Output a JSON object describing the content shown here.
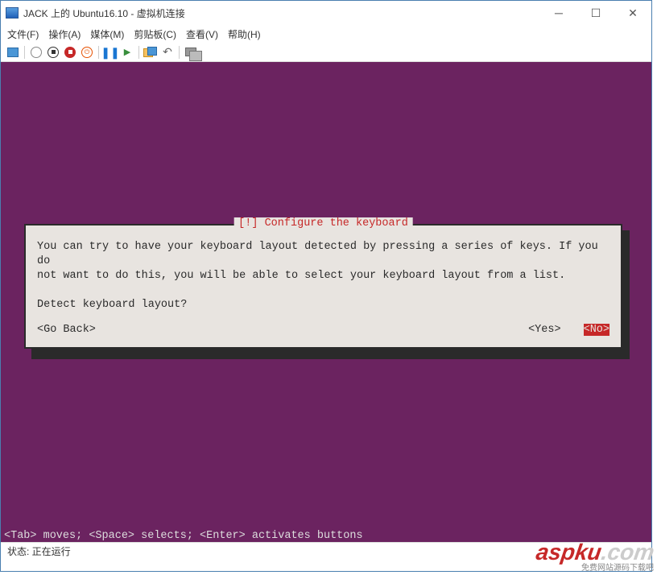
{
  "window": {
    "title": "JACK 上的 Ubuntu16.10 - 虚拟机连接"
  },
  "menu": {
    "file": "文件(F)",
    "action": "操作(A)",
    "media": "媒体(M)",
    "clipboard": "剪贴板(C)",
    "view": "查看(V)",
    "help": "帮助(H)"
  },
  "dialog": {
    "title": "[!] Configure the keyboard",
    "line1": "You can try to have your keyboard layout detected by pressing a series of keys. If you do",
    "line2": "not want to do this, you will be able to select your keyboard layout from a list.",
    "prompt": "Detect keyboard layout?",
    "go_back": "<Go Back>",
    "yes": "<Yes>",
    "no": "<No>"
  },
  "hint": "<Tab> moves; <Space> selects; <Enter> activates buttons",
  "status": {
    "label": "状态: 正在运行"
  },
  "watermark": {
    "brand": "aspku",
    "suffix": ".com",
    "sub": "免费网站源码下载吧"
  }
}
